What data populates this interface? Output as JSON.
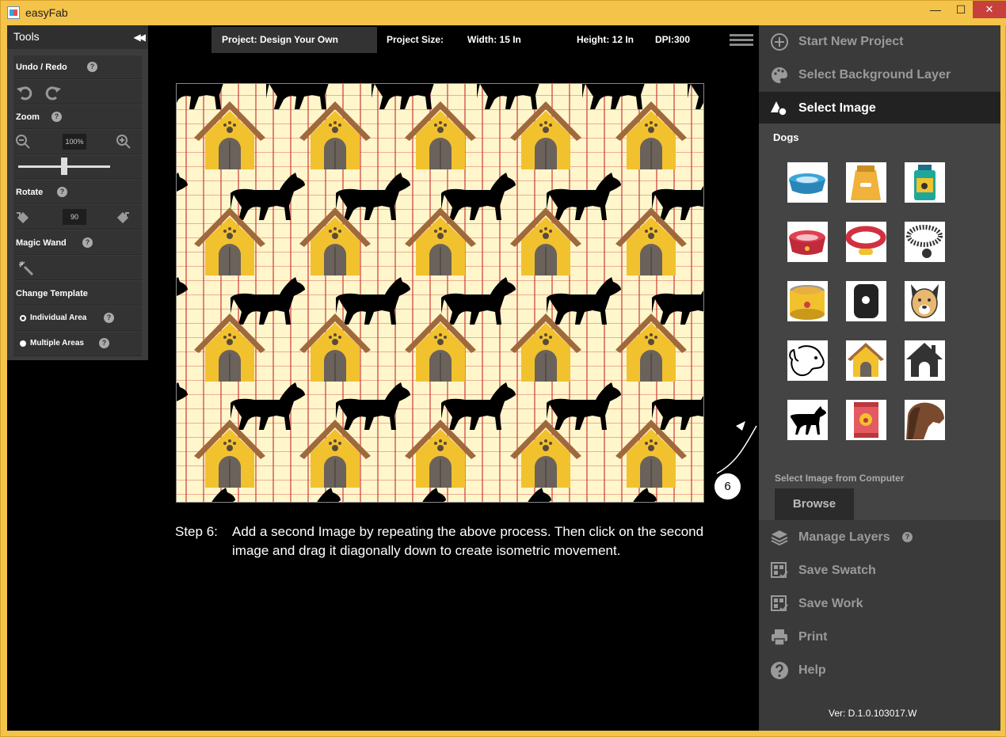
{
  "window": {
    "title": "easyFab",
    "minimize": "—",
    "maximize": "☐",
    "close": "✕"
  },
  "tools": {
    "title": "Tools",
    "collapse": "◀◀",
    "undo_redo": "Undo / Redo",
    "zoom": "Zoom",
    "zoom_value": "100%",
    "zoom_slider": 0.5,
    "rotate": "Rotate",
    "rotate_value": "90",
    "magic_wand": "Magic Wand",
    "change_template": "Change Template",
    "individual_area": "Individual Area",
    "multiple_areas": "Multiple Areas",
    "help": "?"
  },
  "topbar": {
    "project": "Project: Design Your Own",
    "size_label": "Project Size:",
    "width": "Width: 15 In",
    "height": "Height: 12 In",
    "dpi": "DPI:300"
  },
  "step": {
    "number": "Step 6:",
    "text": "Add a second Image by repeating the above process. Then click on the second image and drag it diagonally down to create isometric movement."
  },
  "callout": "6",
  "sidebar": {
    "items": [
      {
        "label": "Start New Project"
      },
      {
        "label": "Select Background Layer"
      },
      {
        "label": "Select Image"
      },
      {
        "label": "Manage Layers"
      },
      {
        "label": "Save Swatch"
      },
      {
        "label": "Save Work"
      },
      {
        "label": "Print"
      },
      {
        "label": "Help"
      }
    ],
    "category": "Dogs",
    "from_computer": "Select Image from Computer",
    "browse": "Browse",
    "version": "Ver: D.1.0.103017.W"
  },
  "colors": {
    "accent": "#f4c34a",
    "house": "#f2c12e",
    "roof": "#9a6a3a",
    "door": "#6b625c",
    "close": "#c7403b"
  }
}
